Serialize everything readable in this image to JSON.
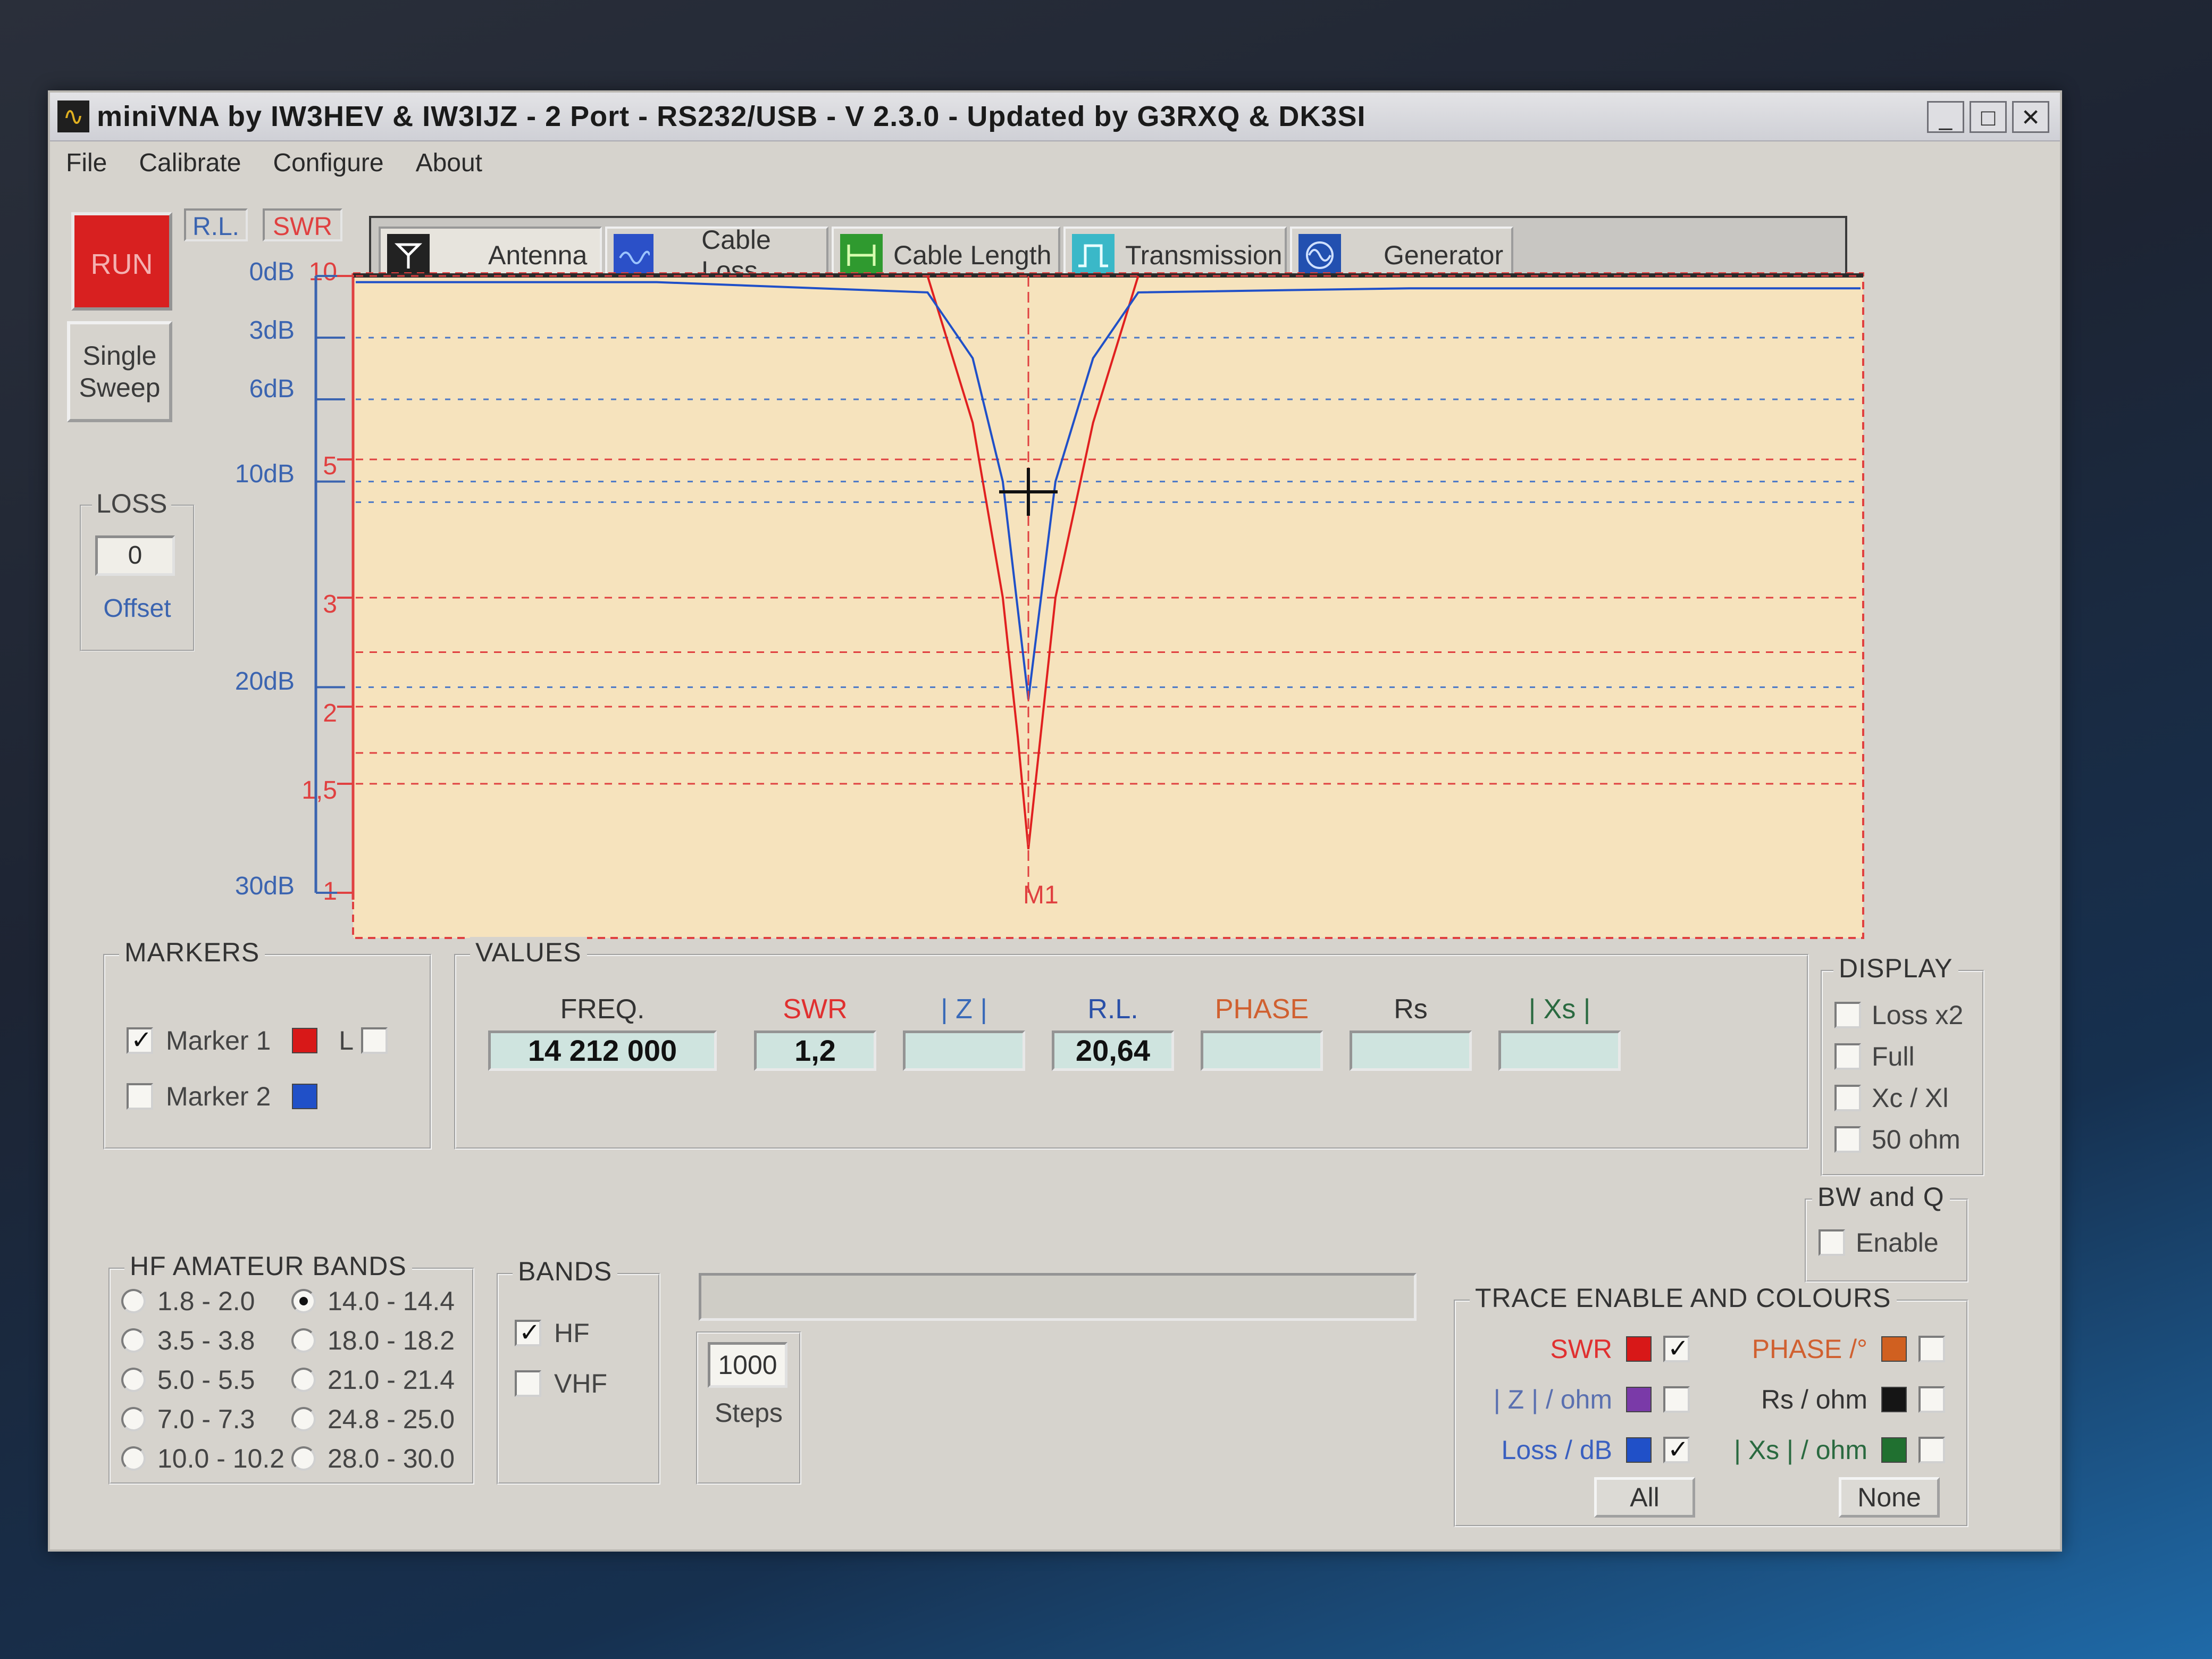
{
  "window": {
    "title": "miniVNA by IW3HEV & IW3IJZ - 2 Port - RS232/USB - V 2.3.0 - Updated by G3RXQ & DK3SI",
    "controls": [
      "_",
      "□",
      "✕"
    ]
  },
  "menu": [
    "File",
    "Calibrate",
    "Configure",
    "About"
  ],
  "buttons": {
    "run": "RUN",
    "single_sweep_line1": "Single",
    "single_sweep_line2": "Sweep"
  },
  "axis_chips": {
    "rl": "R.L.",
    "swr": "SWR"
  },
  "loss": {
    "title": "LOSS",
    "value": "0",
    "offset_label": "Offset"
  },
  "tabs": [
    {
      "label": "Antenna",
      "icon": "antenna-icon",
      "active": true
    },
    {
      "label": "Cable Loss",
      "icon": "cable-loss-icon",
      "active": false
    },
    {
      "label": "Cable Length",
      "icon": "cable-length-icon",
      "active": false
    },
    {
      "label": "Transmission",
      "icon": "transmission-icon",
      "active": false
    },
    {
      "label": "Generator",
      "icon": "generator-icon",
      "active": false
    }
  ],
  "chart_data": {
    "type": "line",
    "rl_axis": {
      "labels": [
        "0dB",
        "3dB",
        "6dB",
        "10dB",
        "20dB",
        "30dB"
      ],
      "values": [
        0,
        3,
        6,
        10,
        20,
        30
      ],
      "range": [
        0,
        30
      ]
    },
    "swr_axis": {
      "labels": [
        "10",
        "5",
        "3",
        "2",
        "1,5",
        "1"
      ],
      "values": [
        10,
        5,
        3,
        2,
        1.5,
        1
      ],
      "range": [
        1,
        10
      ]
    },
    "x": {
      "range": [
        0,
        1
      ],
      "unit": "fraction of sweep"
    },
    "marker": {
      "label": "M1",
      "x": 0.447,
      "swr": 1.2,
      "rl_db": 20.64
    },
    "series": [
      {
        "name": "SWR",
        "color": "#e02020",
        "x": [
          0.38,
          0.41,
          0.43,
          0.44,
          0.447,
          0.455,
          0.465,
          0.49,
          0.52
        ],
        "y": [
          10,
          6,
          3,
          1.8,
          1.2,
          1.8,
          3,
          6,
          10
        ]
      },
      {
        "name": "Loss / dB",
        "color": "#2050c8",
        "x": [
          0,
          0.2,
          0.38,
          0.41,
          0.43,
          0.447,
          0.465,
          0.49,
          0.52,
          0.7,
          1.0
        ],
        "y": [
          0.3,
          0.3,
          0.8,
          4,
          10,
          20.6,
          10,
          4,
          0.8,
          0.6,
          0.6
        ]
      }
    ],
    "swr_gridlines": [
      10,
      5,
      3,
      2.5,
      2,
      1.7,
      1.5
    ],
    "rl_gridlines": [
      3,
      6,
      10,
      11,
      20
    ]
  },
  "markers": {
    "title": "MARKERS",
    "marker1": {
      "label": "Marker 1",
      "checked": true,
      "color": "#d81818"
    },
    "marker1_l": {
      "label": "L",
      "checked": false
    },
    "marker2": {
      "label": "Marker 2",
      "checked": false,
      "color": "#2050c8"
    }
  },
  "values": {
    "title": "VALUES",
    "freq": {
      "label": "FREQ.",
      "value": "14 212 000",
      "color": "#333333"
    },
    "swr": {
      "label": "SWR",
      "value": "1,2",
      "color": "#e03030"
    },
    "z": {
      "label": "| Z |",
      "value": "",
      "color": "#3a6ab8"
    },
    "rl": {
      "label": "R.L.",
      "value": "20,64",
      "color": "#2a50a8"
    },
    "phase": {
      "label": "PHASE",
      "value": "",
      "color": "#d06030"
    },
    "rs": {
      "label": "Rs",
      "value": "",
      "color": "#333333"
    },
    "xs": {
      "label": "| Xs |",
      "value": "",
      "color": "#2a6a40"
    }
  },
  "display": {
    "title": "DISPLAY",
    "options": [
      {
        "label": "Loss x2",
        "checked": false
      },
      {
        "label": "Full",
        "checked": false
      },
      {
        "label": "Xc / Xl",
        "checked": false
      },
      {
        "label": "50 ohm",
        "checked": false
      }
    ]
  },
  "bwq": {
    "title": "BW and Q",
    "enable_label": "Enable",
    "checked": false
  },
  "hf_bands": {
    "title": "HF AMATEUR BANDS",
    "left": [
      {
        "label": "1.8 - 2.0",
        "selected": false
      },
      {
        "label": "3.5 - 3.8",
        "selected": false
      },
      {
        "label": "5.0 - 5.5",
        "selected": false
      },
      {
        "label": "7.0 - 7.3",
        "selected": false
      },
      {
        "label": "10.0 - 10.2",
        "selected": false
      }
    ],
    "right": [
      {
        "label": "14.0 - 14.4",
        "selected": true
      },
      {
        "label": "18.0 - 18.2",
        "selected": false
      },
      {
        "label": "21.0 - 21.4",
        "selected": false
      },
      {
        "label": "24.8 - 25.0",
        "selected": false
      },
      {
        "label": "28.0 - 30.0",
        "selected": false
      }
    ]
  },
  "bands": {
    "title": "BANDS",
    "hf": {
      "label": "HF",
      "checked": true
    },
    "vhf": {
      "label": "VHF",
      "checked": false
    }
  },
  "steps": {
    "value": "1000",
    "label": "Steps"
  },
  "traces": {
    "title": "TRACE ENABLE AND COLOURS",
    "rows": [
      {
        "left": {
          "label": "SWR",
          "color": "#d81818",
          "text_color": "#e03030",
          "checked": true
        },
        "right": {
          "label": "PHASE /°",
          "color": "#d06020",
          "text_color": "#d06030",
          "checked": false
        }
      },
      {
        "left": {
          "label": "| Z | / ohm",
          "color": "#7a3aa8",
          "text_color": "#5a70b0",
          "checked": false
        },
        "right": {
          "label": "Rs / ohm",
          "color": "#151515",
          "text_color": "#333333",
          "checked": false
        }
      },
      {
        "left": {
          "label": "Loss / dB",
          "color": "#2050c8",
          "text_color": "#3a60c0",
          "checked": true
        },
        "right": {
          "label": "| Xs | / ohm",
          "color": "#207030",
          "text_color": "#2a6a40",
          "checked": false
        }
      }
    ],
    "all_label": "All",
    "none_label": "None"
  }
}
